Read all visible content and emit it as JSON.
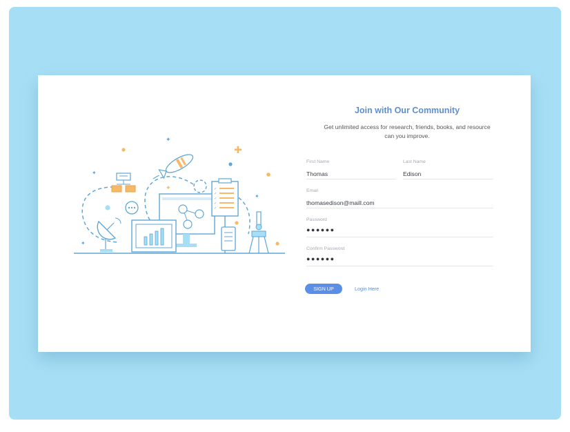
{
  "colors": {
    "backdrop": "#a6dff5",
    "card": "#ffffff",
    "accent": "#5b8fd3",
    "button": "#5b8fe6",
    "illustration_orange": "#f6b968",
    "illustration_blue": "#5fa5d6"
  },
  "illustration": {
    "icons": [
      "satellite-dish-icon",
      "rocket-icon",
      "monitor-icon",
      "tablet-chart-icon",
      "clipboard-checklist-icon",
      "microscope-icon",
      "phone-icon",
      "chat-bubble-icon",
      "flowchart-icon",
      "sparkle-icon"
    ]
  },
  "form": {
    "title": "Join with Our Community",
    "subtitle": "Get unlimited access for research, friends, books, and resource can you improve.",
    "first_name": {
      "label": "First Name",
      "value": "Thomas"
    },
    "last_name": {
      "label": "Last Name",
      "value": "Edison"
    },
    "email": {
      "label": "Email",
      "value": "thomasedison@maill.com"
    },
    "password": {
      "label": "Password",
      "value": "●●●●●●"
    },
    "confirm_password": {
      "label": "Confirm Password",
      "value": "●●●●●●"
    },
    "signup_label": "SIGN UP",
    "login_label": "Login Here"
  }
}
